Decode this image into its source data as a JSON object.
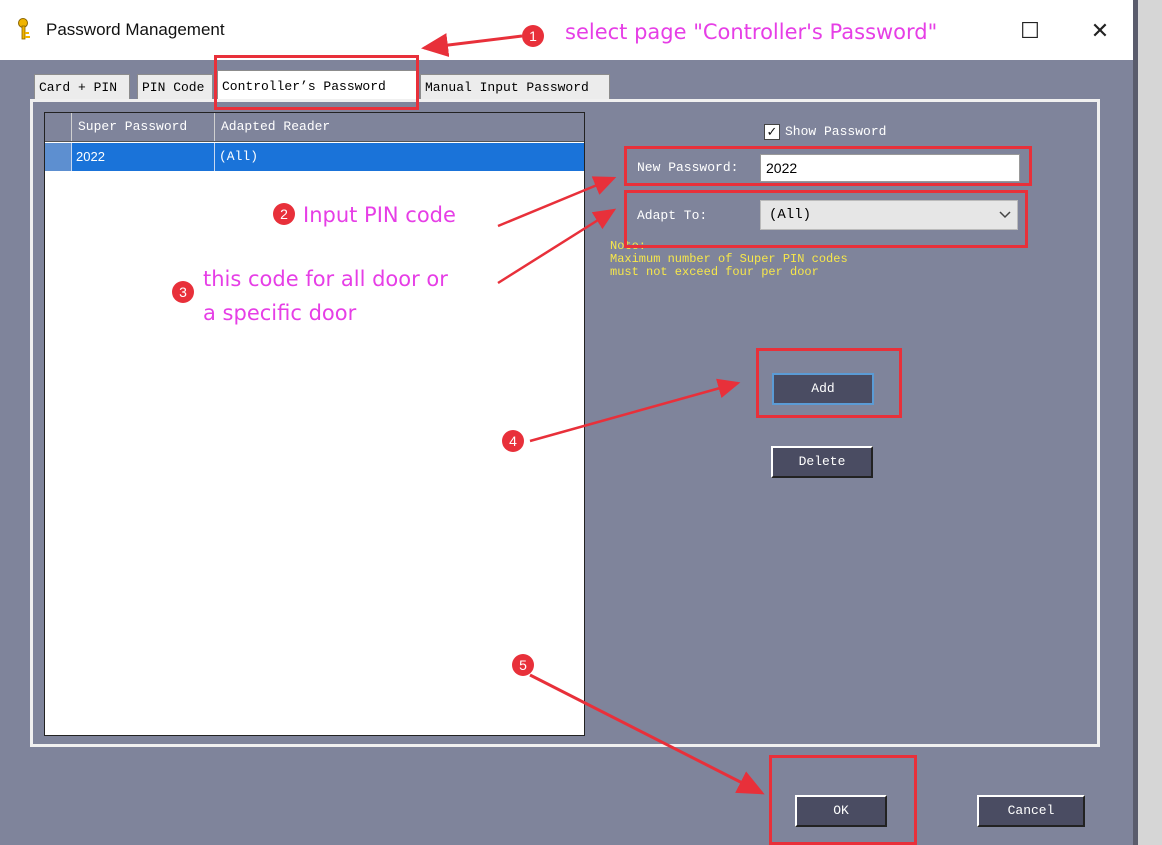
{
  "window": {
    "title": "Password Management",
    "maximize_glyph": "☐",
    "close_glyph": "✕"
  },
  "tabs": [
    {
      "label": "Card + PIN"
    },
    {
      "label": "PIN Code"
    },
    {
      "label": "Controller’s Password"
    },
    {
      "label": "Manual Input Password"
    }
  ],
  "list": {
    "columns": [
      "Super Password",
      "Adapted Reader"
    ],
    "rows": [
      {
        "super_password": "2022",
        "adapted_reader": "(All)"
      }
    ]
  },
  "form": {
    "show_password_label": "Show Password",
    "show_password_checked": true,
    "check_glyph": "✓",
    "new_password_label": "New Password:",
    "new_password_value": "2022",
    "adapt_to_label": "Adapt To:",
    "adapt_to_value": "(All)",
    "note_title": "Note:",
    "note_line1": "Maximum number of Super PIN codes",
    "note_line2": "must not exceed four per door"
  },
  "buttons": {
    "add": "Add",
    "delete": "Delete",
    "ok": "OK",
    "cancel": "Cancel"
  },
  "annotations": {
    "step1": {
      "num": "1",
      "text": "select page \"Controller's Password\""
    },
    "step2": {
      "num": "2",
      "text": "Input PIN code"
    },
    "step3": {
      "num": "3",
      "line1": "this code for all door or",
      "line2": "a specific door"
    },
    "step4": {
      "num": "4"
    },
    "step5": {
      "num": "5"
    }
  },
  "colors": {
    "dialog_bg": "#7f849b",
    "selection": "#1a73d9",
    "annotation_red": "#e8303a",
    "annotation_text": "#e63ee6",
    "note_text": "#f7e74a"
  }
}
